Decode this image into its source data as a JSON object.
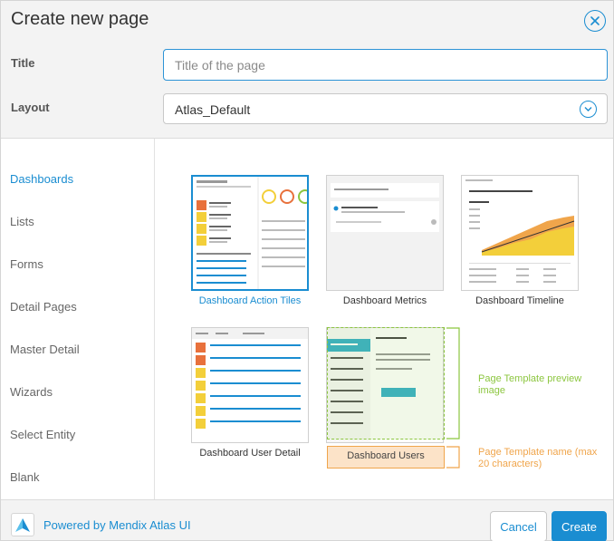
{
  "dialog": {
    "title": "Create new page"
  },
  "form": {
    "title_label": "Title",
    "title_placeholder": "Title of the page",
    "title_value": "",
    "layout_label": "Layout",
    "layout_value": "Atlas_Default"
  },
  "sidebar": {
    "items": [
      {
        "label": "Dashboards",
        "active": true
      },
      {
        "label": "Lists",
        "active": false
      },
      {
        "label": "Forms",
        "active": false
      },
      {
        "label": "Detail Pages",
        "active": false
      },
      {
        "label": "Master Detail",
        "active": false
      },
      {
        "label": "Wizards",
        "active": false
      },
      {
        "label": "Select Entity",
        "active": false
      },
      {
        "label": "Blank",
        "active": false
      }
    ]
  },
  "templates": [
    {
      "name": "Dashboard Action Tiles",
      "selected": true,
      "preview": {
        "title": "Groeterdingen, Henk",
        "rows": [
          "WORKFLOW 9283",
          "WORKFLOW 7890",
          "WORKFLOW 7890",
          "WORKFLOW 7890"
        ]
      }
    },
    {
      "name": "Dashboard Metrics",
      "selected": false,
      "preview": {
        "title": "Shaktaam gemeld",
        "sub": "Vandaag 08:30"
      }
    },
    {
      "name": "Dashboard Timeline",
      "selected": false,
      "preview": {
        "title": "Voorinschrijvend resultaat actuele maand",
        "sub": "Resultaat"
      }
    },
    {
      "name": "Dashboard User Detail",
      "selected": false,
      "preview": {
        "rows": [
          "WORKFLOW 9283",
          "WORKFLOW 7890",
          "WORKFLOW 7890",
          "WORKFLOW 7890",
          "WORKFLOW 7890",
          "WORKFLOW 7890"
        ]
      }
    },
    {
      "name": "Dashboard Users",
      "selected": false,
      "preview": {
        "title": "Blueprint 2017",
        "sub": "Hoi Dennis,",
        "rows": [
          "KORONZ0160191",
          "KORONZ0160179",
          "KORONZ0160163",
          "KORONZ0160134",
          "KORONZ0160119",
          "KORONZ0160108"
        ]
      }
    }
  ],
  "annotations": {
    "preview_image": "Page Template preview image",
    "template_name": "Page Template name (max 20 characters)"
  },
  "footer": {
    "powered_by": "Powered by Mendix Atlas UI",
    "cancel_label": "Cancel",
    "create_label": "Create"
  },
  "colors": {
    "accent": "#1a8dd1",
    "annotation_green": "#8cc63f",
    "annotation_orange": "#f0a54b",
    "header_bg": "#f3f3f3"
  },
  "icons": {
    "close": "close-circle-icon",
    "select": "chevron-down-circle-icon",
    "logo": "mendix-atlas-logo-icon"
  }
}
